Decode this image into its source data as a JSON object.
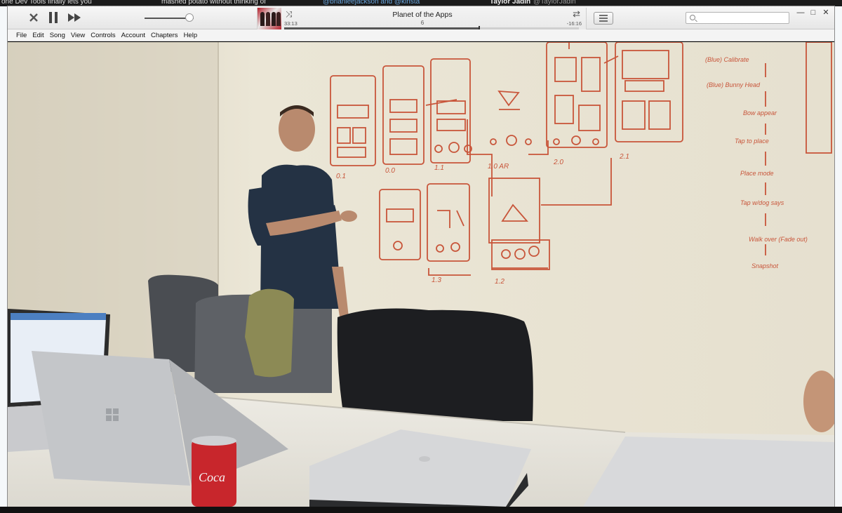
{
  "background": {
    "top_texts": [
      "mashed potato without thinking of",
      "@brianleejackson and @kinsta",
      "Taylor Jadin",
      "@TaylorJadin",
      "one Dev Tools finally lets you"
    ]
  },
  "player": {
    "window_title": "Planet of the Apps",
    "episode": "6",
    "elapsed": "33:13",
    "remaining": "-16:16",
    "progress": 0.66,
    "volume": 0.92
  },
  "menu": [
    "File",
    "Edit",
    "Song",
    "View",
    "Controls",
    "Account",
    "Chapters",
    "Help"
  ],
  "search": {
    "placeholder": "",
    "value": ""
  },
  "whiteboard": {
    "screen_labels": [
      "0.1",
      "0.0",
      "1.1",
      "1.0 AR",
      "2.0",
      "2.1",
      "1.3",
      "1.2"
    ],
    "flow_notes": [
      "(Blue) Calibrate",
      "(Blue) Bunny Head",
      "Bow appear",
      "Tap to place",
      "Place mode",
      "Tap w/dog says",
      "Walk over (Fade out)",
      "Snapshot"
    ]
  },
  "colors": {
    "marker": "#c8553a",
    "wall": "#e7e2d3",
    "table": "#ece9e1"
  }
}
